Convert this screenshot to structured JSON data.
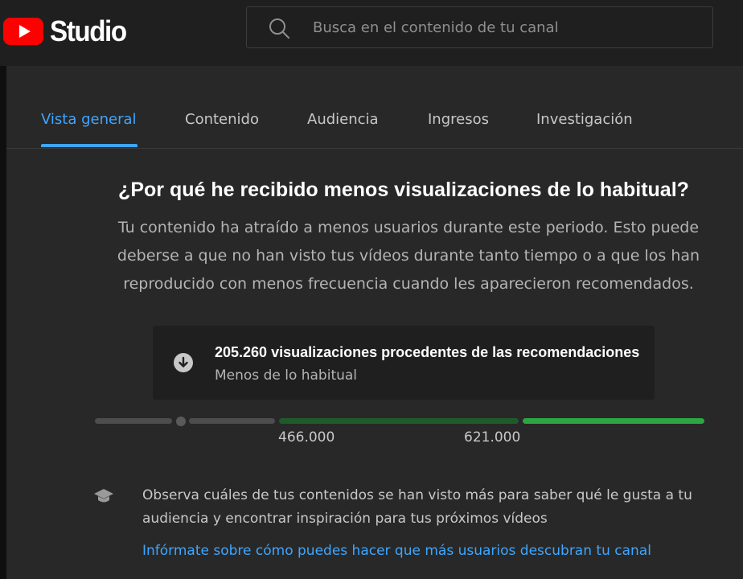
{
  "app": {
    "logo_text": "Studio",
    "brand_color": "#ff0000"
  },
  "search": {
    "placeholder": "Busca en el contenido de tu canal",
    "value": ""
  },
  "tabs": [
    {
      "label": "Vista general",
      "active": true
    },
    {
      "label": "Contenido",
      "active": false
    },
    {
      "label": "Audiencia",
      "active": false
    },
    {
      "label": "Ingresos",
      "active": false
    },
    {
      "label": "Investigación",
      "active": false
    }
  ],
  "insight": {
    "heading": "¿Por qué he recibido menos visualizaciones de lo habitual?",
    "description": "Tu contenido ha atraído a menos usuarios durante este periodo. Esto puede deberse a que no han visto tus vídeos durante tanto tiempo o a que los han reproducido con menos frecuencia cuando les aparecieron recomendados.",
    "stat_title": "205.260 visualizaciones procedentes de las recomendaciones",
    "stat_subtitle": "Menos de lo habitual",
    "stat_icon": "arrow-down-circle-icon"
  },
  "range": {
    "value": 205260,
    "low_label": "466.000",
    "high_label": "621.000",
    "colors": {
      "below": "#4d4d4d",
      "typical": "#1e5a2a",
      "above": "#2ba640"
    }
  },
  "tip": {
    "icon": "graduation-cap-icon",
    "text": "Observa cuáles de tus contenidos se han visto más para saber qué le gusta a tu audiencia y encontrar inspiración para tus próximos vídeos",
    "link": "Infórmate sobre cómo puedes hacer que más usuarios descubran tu canal"
  },
  "colors": {
    "accent": "#3ea6ff",
    "panel": "#282828",
    "topbar": "#1f1f1f"
  }
}
